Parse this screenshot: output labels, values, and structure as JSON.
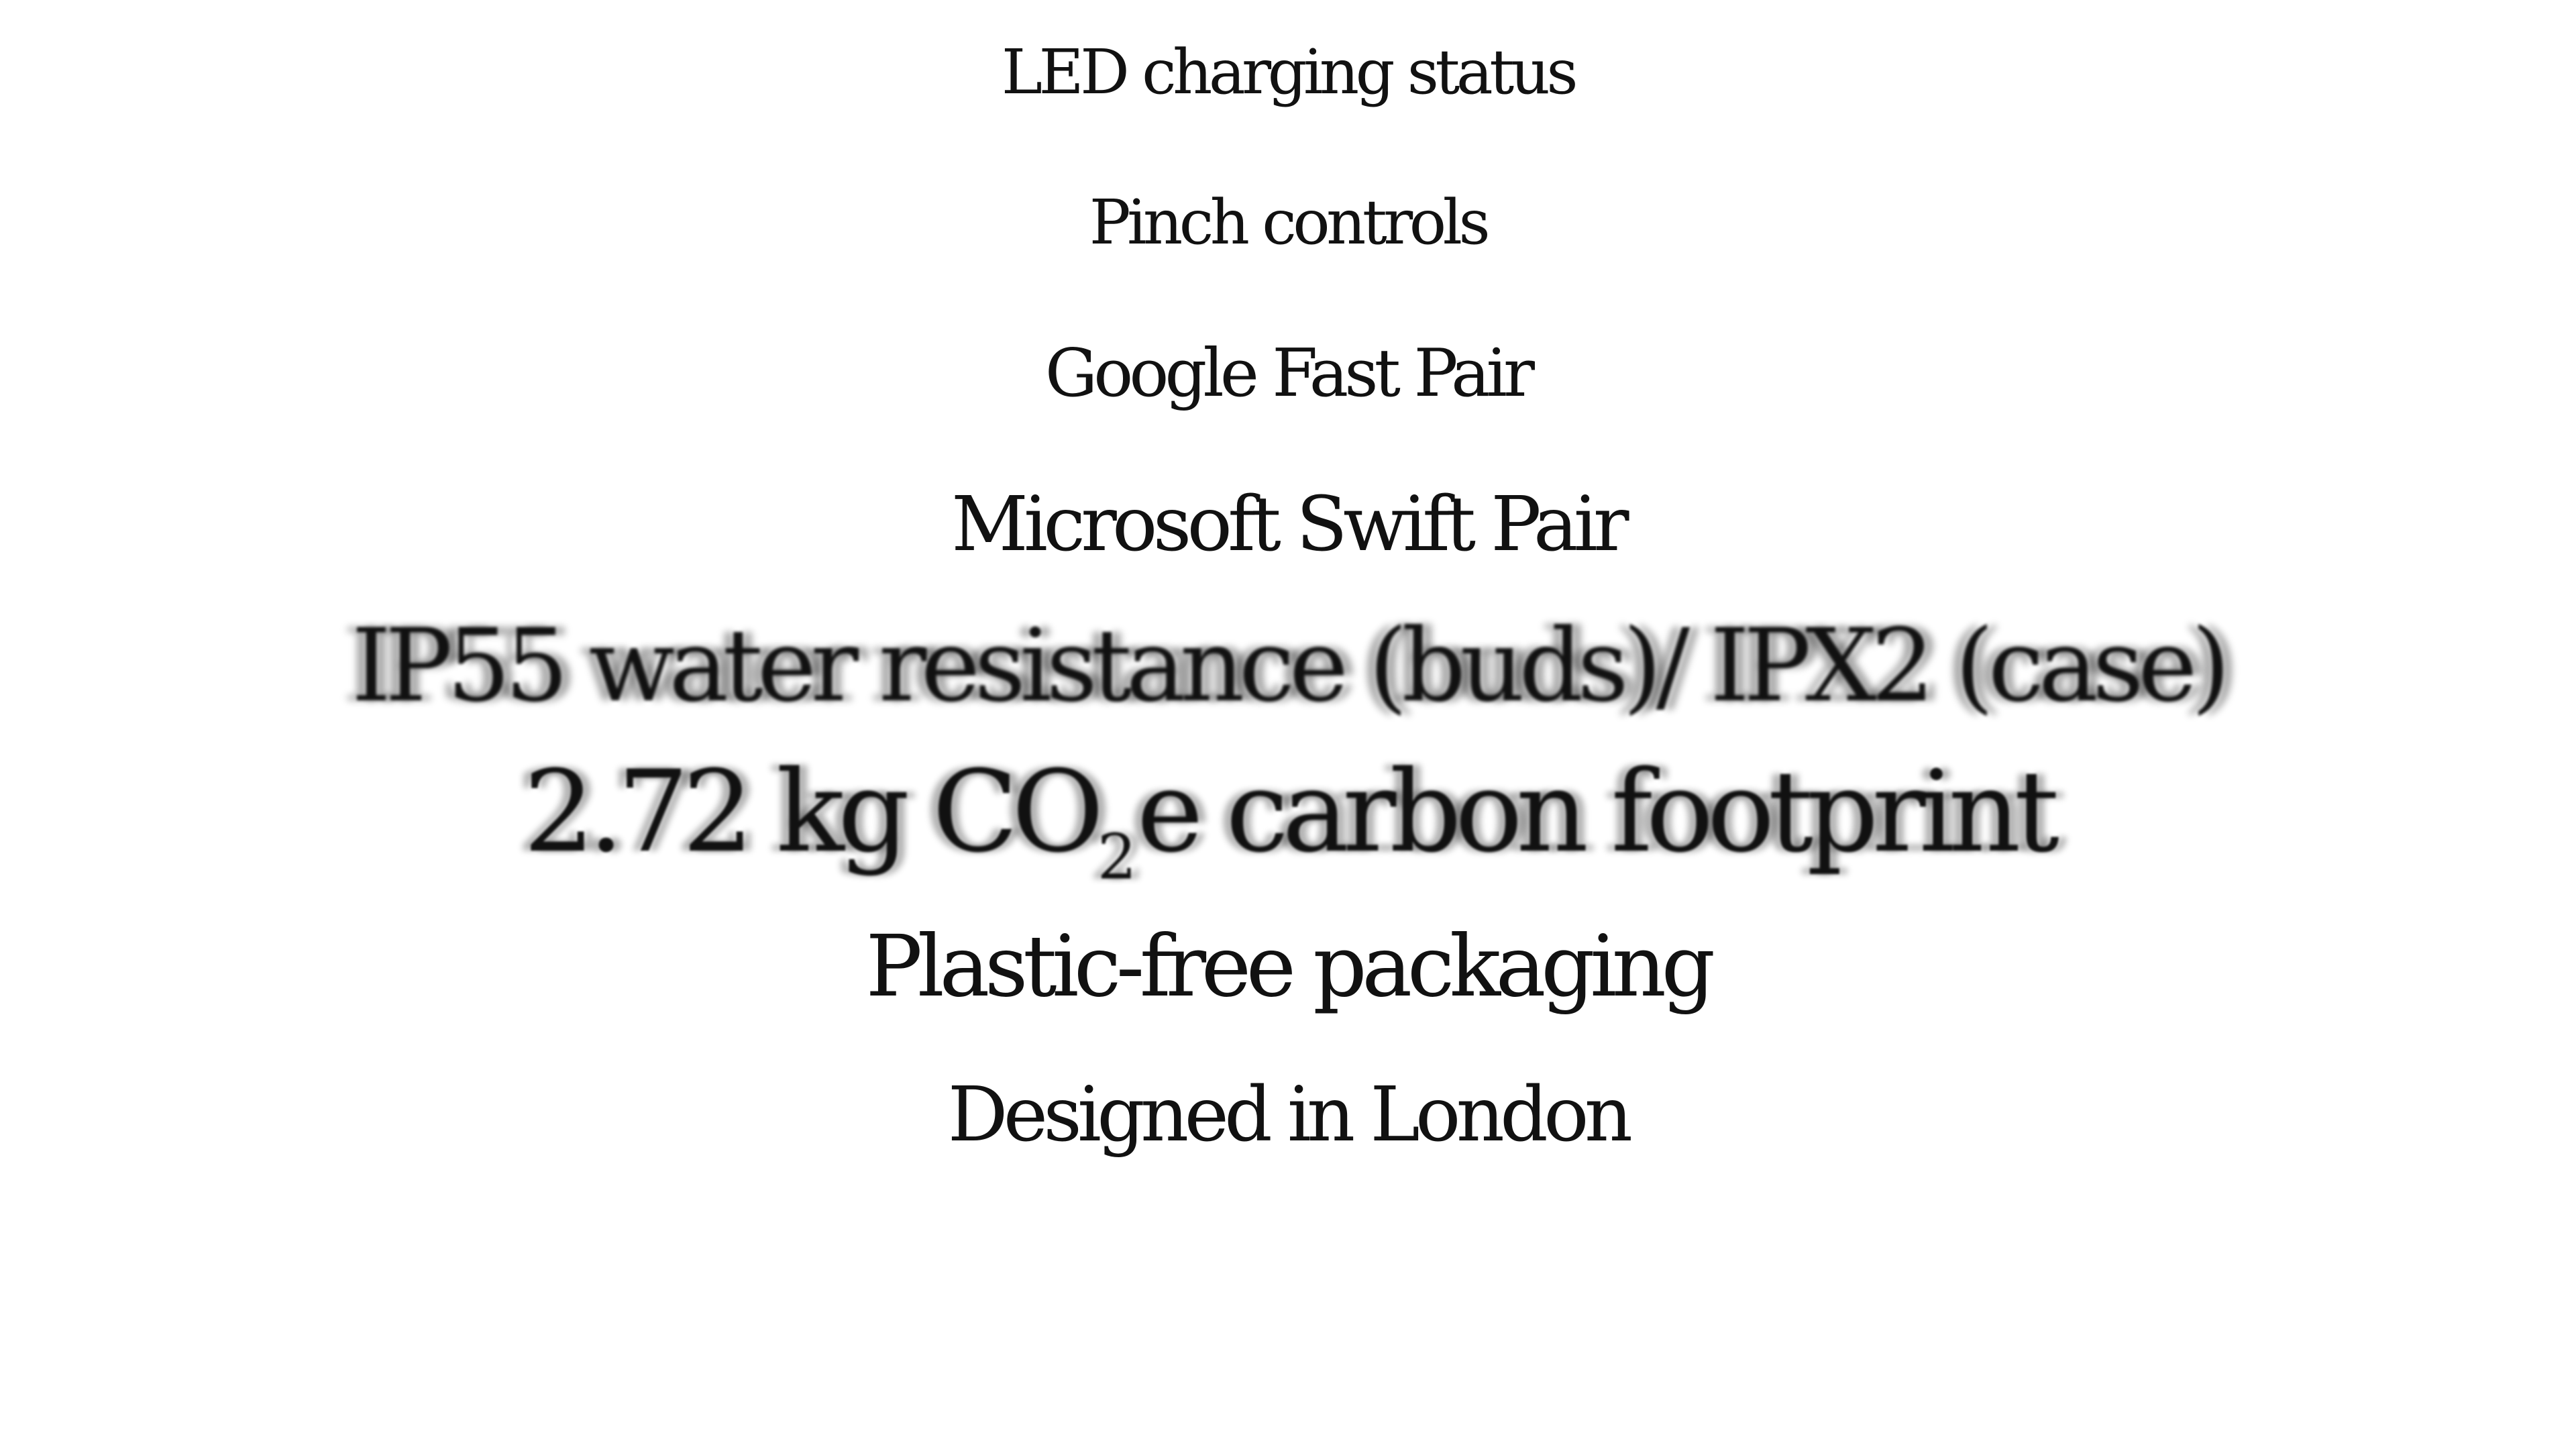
{
  "features": {
    "line1": "LED charging status",
    "line2": "Pinch controls",
    "line3": "Google Fast Pair",
    "line4": "Microsoft Swift Pair",
    "line5": "IP55 water resistance (buds)/ IPX2 (case)",
    "line6_prefix": "2.72 kg CO",
    "line6_subscript": "2",
    "line6_suffix": "e carbon footprint",
    "line7": "Plastic-free packaging",
    "line8": "Designed in London"
  },
  "colors": {
    "background": "#ffffff",
    "text": "#111111"
  }
}
